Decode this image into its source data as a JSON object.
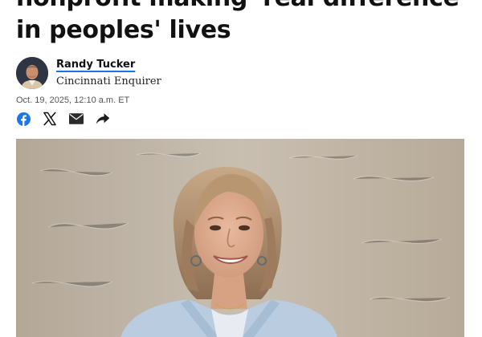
{
  "article": {
    "headline": "nonprofit making 'real difference' in peoples' lives",
    "author": "Randy Tucker",
    "publication": "Cincinnati Enquirer",
    "timestamp": "Oct. 19, 2025, 12:10 a.m. ET"
  },
  "share": {
    "buttons": [
      {
        "name": "facebook",
        "icon": "facebook-icon"
      },
      {
        "name": "x",
        "icon": "x-icon"
      },
      {
        "name": "email",
        "icon": "mail-icon"
      },
      {
        "name": "share",
        "icon": "share-arrow-icon"
      }
    ]
  },
  "colors": {
    "facebook": "#1877f2",
    "text": "#111111",
    "link_underline": "#1a73e8",
    "icon": "#222222"
  }
}
